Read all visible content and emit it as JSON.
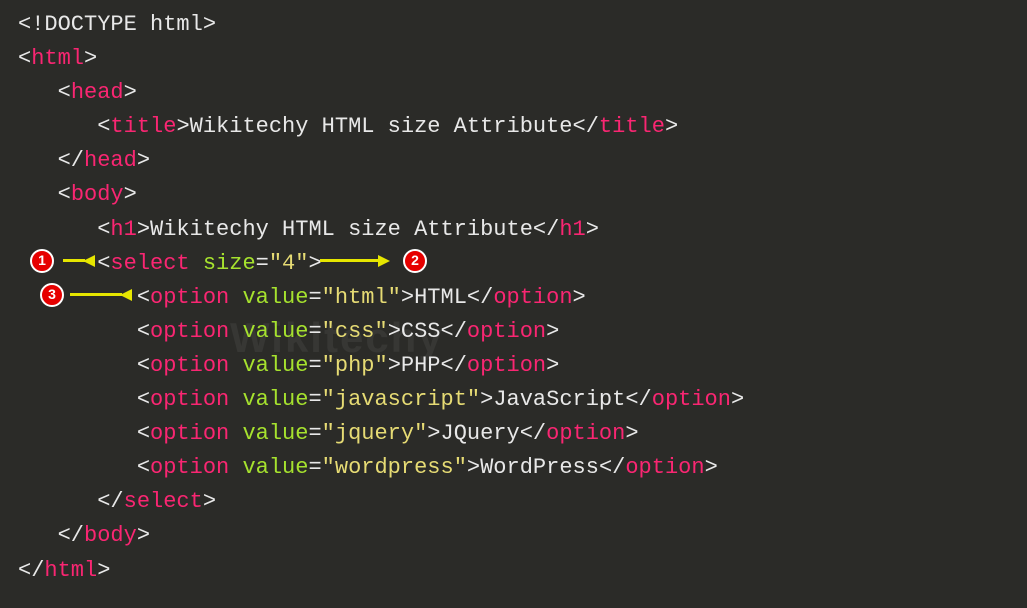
{
  "code": {
    "doctype": "<!DOCTYPE html>",
    "html_open": "html",
    "head_open": "head",
    "title_tag": "title",
    "title_text": "Wikitechy HTML size Attribute",
    "head_close": "head",
    "body_open": "body",
    "h1_tag": "h1",
    "h1_text": "Wikitechy HTML size Attribute",
    "select_tag": "select",
    "select_attr": "size",
    "select_val": "\"4\"",
    "option_tag": "option",
    "option_attr": "value",
    "options": [
      {
        "val": "\"html\"",
        "text": "HTML"
      },
      {
        "val": "\"css\"",
        "text": "CSS"
      },
      {
        "val": "\"php\"",
        "text": "PHP"
      },
      {
        "val": "\"javascript\"",
        "text": "JavaScript"
      },
      {
        "val": "\"jquery\"",
        "text": "JQuery"
      },
      {
        "val": "\"wordpress\"",
        "text": "WordPress"
      }
    ],
    "select_close": "select",
    "body_close": "body",
    "html_close": "html"
  },
  "annotations": {
    "badge1": "1",
    "badge2": "2",
    "badge3": "3"
  },
  "watermark": "Wikitechy"
}
